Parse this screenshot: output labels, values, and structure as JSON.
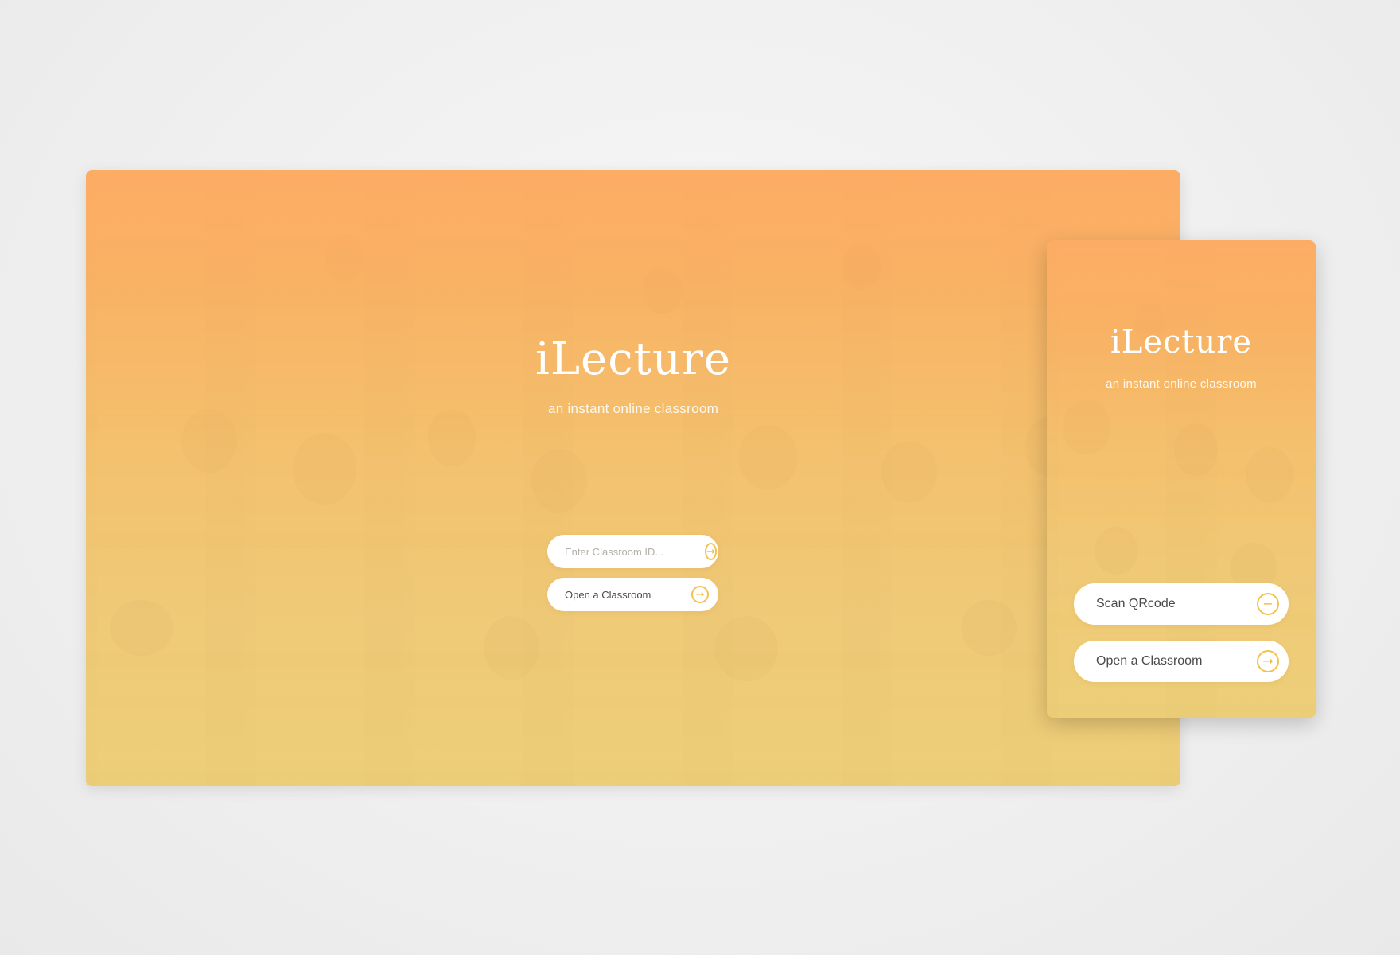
{
  "desktop": {
    "title": "iLecture",
    "tagline": "an instant online classroom",
    "classroom_id_placeholder": "Enter Classroom ID...",
    "open_classroom_label": "Open a Classroom"
  },
  "mobile": {
    "title": "iLecture",
    "tagline": "an instant online classroom",
    "scan_label": "Scan QRcode",
    "open_classroom_label": "Open a Classroom"
  },
  "icons": {
    "arrow": "→",
    "minus": "−"
  },
  "colors": {
    "accent": "#f6c14a",
    "gradient_top": "#ffac64",
    "gradient_bottom": "#f4d478"
  }
}
